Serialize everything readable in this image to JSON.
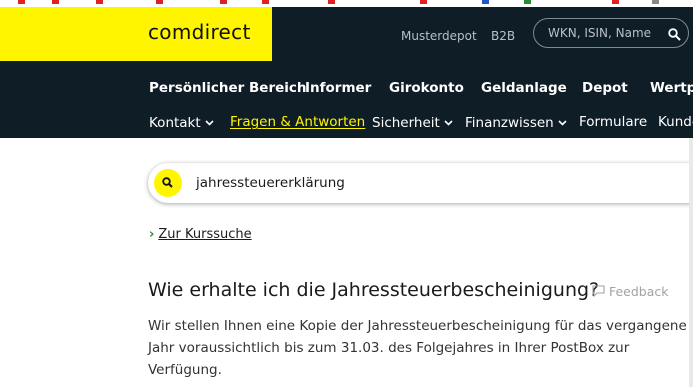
{
  "colors": {
    "brand_yellow": "#fff500",
    "header_bg": "#0f1d26",
    "link_green": "#2e8b3d"
  },
  "header": {
    "logo": "comdirect",
    "util_links": [
      "Musterdepot",
      "B2B"
    ],
    "search_placeholder": "WKN, ISIN, Name",
    "search_icon": "search-icon"
  },
  "nav_primary": [
    "Persönlicher Bereich",
    "Informer",
    "Girokonto",
    "Geldanlage",
    "Depot",
    "Wertp"
  ],
  "nav_secondary": [
    {
      "label": "Kontakt",
      "dropdown": true
    },
    {
      "label": "Fragen & Antworten",
      "active": true
    },
    {
      "label": "Sicherheit",
      "dropdown": true
    },
    {
      "label": "Finanzwissen",
      "dropdown": true
    },
    {
      "label": "Formulare"
    },
    {
      "label": "Kunde"
    }
  ],
  "search": {
    "value": "jahressteuererklärung",
    "icon": "search-icon"
  },
  "back_link": "Zur Kurssuche",
  "faq": {
    "question": "Wie erhalte ich die Jahressteuerbescheinigung?",
    "feedback_label": "Feedback",
    "answer": "Wir stellen Ihnen eine Kopie der Jahressteuerbescheinigung für das vergangene Jahr voraussichtlich bis zum 31.03. des Folgejahres in Ihrer PostBox zur Verfügung."
  }
}
